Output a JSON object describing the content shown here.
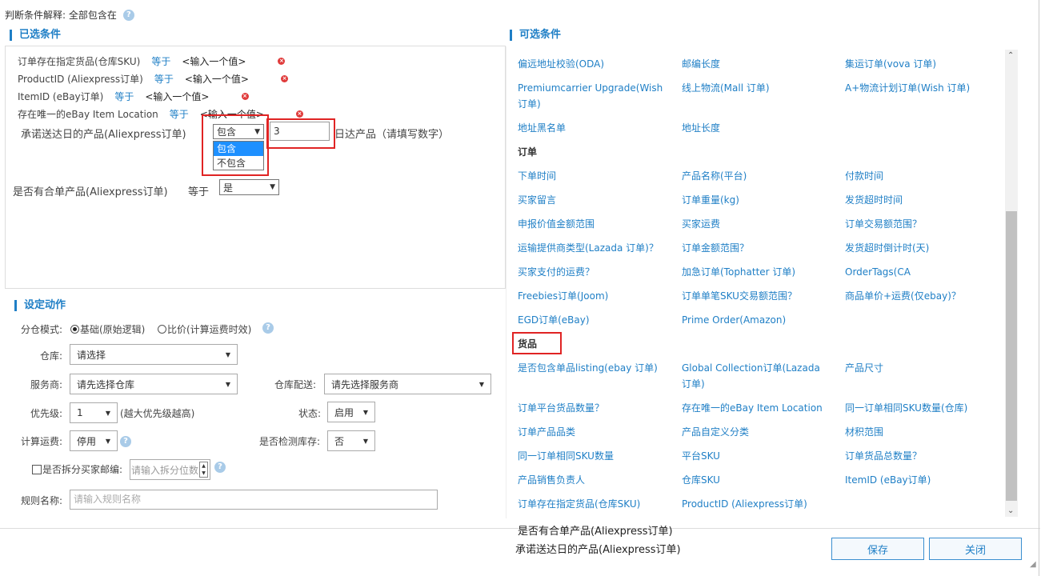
{
  "header": {
    "condition_explain": "判断条件解释: 全部包含在"
  },
  "selected_section": {
    "title": "已选条件",
    "conditions": [
      {
        "field": "订单存在指定货品(仓库SKU)",
        "op": "等于",
        "value": "<输入一个值>"
      },
      {
        "field": "ProductID (Aliexpress订单)",
        "op": "等于",
        "value": "<输入一个值>"
      },
      {
        "field": "ItemID (eBay订单)",
        "op": "等于",
        "value": "<输入一个值>"
      },
      {
        "field": "存在唯一的eBay Item Location",
        "op": "等于",
        "value": "<输入一个值>"
      }
    ],
    "delivery_row": {
      "label": "承诺送达日的产品(Aliexpress订单)",
      "select_value": "包含",
      "input_value": "3",
      "suffix": "日达产品（请填写数字）",
      "options": [
        "包含",
        "不包含"
      ]
    },
    "combine_row": {
      "label": "是否有合单产品(Aliexpress订单)",
      "op": "等于",
      "value": "是"
    }
  },
  "actions_section": {
    "title": "设定动作",
    "mode_label": "分仓模式:",
    "mode_basic": "基础(原始逻辑)",
    "mode_compare": "比价(计算运费时效)",
    "warehouse_label": "仓库:",
    "warehouse_value": "请选择",
    "provider_label": "服务商:",
    "provider_value": "请先选择仓库",
    "wh_delivery_label": "仓库配送:",
    "wh_delivery_value": "请先选择服务商",
    "priority_label": "优先级:",
    "priority_value": "1",
    "priority_hint": "(越大优先级越高)",
    "status_label": "状态:",
    "status_value": "启用",
    "freight_label": "计算运费:",
    "freight_value": "停用",
    "stock_label": "是否检测库存:",
    "stock_value": "否",
    "split_label": "是否拆分买家邮编:",
    "split_placeholder": "请输入拆分位数",
    "rule_label": "规则名称:",
    "rule_placeholder": "请输入规则名称"
  },
  "optional_section": {
    "title": "可选条件",
    "rows": [
      [
        "偏远地址校验(ODA)",
        "邮编长度",
        "集运订单(vova 订单)"
      ],
      [
        "Premiumcarrier Upgrade(Wish 订单)",
        "线上物流(Mall 订单)",
        "A+物流计划订单(Wish 订单)"
      ],
      [
        "地址黑名单",
        "地址长度",
        ""
      ],
      [
        "订单"
      ],
      [
        "下单时间",
        "产品名称(平台)",
        "付款时间"
      ],
      [
        "买家留言",
        "订单重量(kg)",
        "发货超时时间"
      ],
      [
        "申报价值金额范围",
        "买家运费",
        "订单交易额范围？"
      ],
      [
        "运输提供商类型(Lazada 订单)？",
        "订单金额范围？",
        "发货超时倒计时(天)"
      ],
      [
        "买家支付的运费？",
        "加急订单(Tophatter 订单)",
        "OrderTags(CA"
      ],
      [
        "Freebies订单(Joom)",
        "订单单笔SKU交易额范围？",
        "商品单价+运费(仅ebay)？"
      ],
      [
        "EGD订单(eBay)",
        "Prime Order(Amazon)",
        ""
      ],
      [
        "货品"
      ],
      [
        "是否包含单品listing(ebay 订单)",
        "Global Collection订单(Lazada 订单)",
        "产品尺寸"
      ],
      [
        "订单平台货品数量？",
        "存在唯一的eBay Item Location",
        "同一订单相同SKU数量(仓库)"
      ],
      [
        "订单产品品类",
        "产品自定义分类",
        "材积范围"
      ],
      [
        "同一订单相同SKU数量",
        "平台SKU",
        "订单货品总数量？"
      ],
      [
        "产品销售负责人",
        "仓库SKU",
        "ItemID (eBay订单)"
      ],
      [
        "订单存在指定货品(仓库SKU)",
        "ProductID (Aliexpress订单)",
        ""
      ]
    ]
  },
  "drag_items": [
    "是否有合单产品(Aliexpress订单)",
    "承诺送达日的产品(Aliexpress订单)"
  ],
  "buttons": {
    "save": "保存",
    "close": "关闭"
  }
}
